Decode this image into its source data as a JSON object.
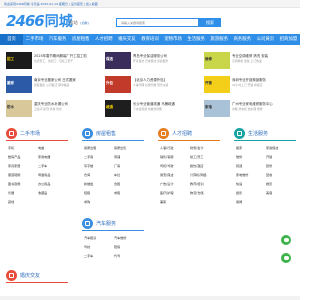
{
  "topbar": {
    "text": "欢迎来到2466同城 今天是 2025-01-19 星期日 | 设为首页 | 加入收藏"
  },
  "logo": {
    "number": "2466",
    "name": "同城"
  },
  "city": {
    "name": "· 总站",
    "switch": "[切换]"
  },
  "search": {
    "placeholder": "请输入关键词搜索",
    "button": "搜索"
  },
  "nav": [
    "首页",
    "二手市场",
    "汽车服务",
    "房屋租售",
    "人才招聘",
    "婚庆交友",
    "教育培训",
    "宠物市场",
    "生活服务",
    "旅游服务",
    "商务服务",
    "公司黄页",
    "招商加盟"
  ],
  "listings": [
    {
      "title": "2025年春节期间服装厂开工招工啦",
      "desc": "急招普工、缝纫工、包装工若干",
      "thumb": "招工",
      "thumb_bg": "#1b1b1b",
      "thumb_fg": "#f5d000"
    },
    {
      "title": "青岛专业保洁服务公司",
      "desc": "开荒保洁 日常保洁 家政服务",
      "thumb": "保洁",
      "thumb_bg": "#3a2d5c",
      "thumb_fg": "#ffffff"
    },
    {
      "title": "专业空调维修 清洗 安装",
      "desc": "空调移机 加氟 上门快速",
      "thumb": "维修",
      "thumb_bg": "#c9d64a",
      "thumb_fg": "#333333"
    },
    {
      "title": "南京专业搬家公司 日式搬家",
      "desc": "居民搬家 公司搬迁 钢琴搬运",
      "thumb": "搬家",
      "thumb_bg": "#2d5aa6",
      "thumb_fg": "#ffffff"
    },
    {
      "title": "【北京人力资源外包】",
      "desc": "人事代理 社保代缴 劳务派遣",
      "thumb": "外包",
      "thumb_bg": "#c23a2a",
      "thumb_fg": "#ffffff"
    },
    {
      "title": "深圳专业开锁换锁服务",
      "desc": "24小时上门 开锁 换锁芯",
      "thumb": "开锁",
      "thumb_bg": "#f3cf1a",
      "thumb_fg": "#333333"
    },
    {
      "title": "重庆专业防水补漏公司",
      "desc": "卫生间 屋顶 外墙 防水",
      "thumb": "防水",
      "thumb_bg": "#d8c89a",
      "thumb_fg": "#333333"
    },
    {
      "title": "长沙专业管道疏通 马桶疏通",
      "desc": "下水道疏通 化粪池清理",
      "thumb": "疏通",
      "thumb_bg": "#1e1e1e",
      "thumb_fg": "#f5d000"
    },
    {
      "title": "广州专业家电维修服务中心",
      "desc": "冰箱 洗衣机 热水器 维修",
      "thumb": "家电",
      "thumb_bg": "#a9c2d8",
      "thumb_fg": "#333333"
    }
  ],
  "categories": [
    {
      "name": "二手市场",
      "sub": "",
      "color": "#e74c3c",
      "links": [
        "手机",
        "电脑",
        "数码产品",
        "家用电器",
        "家具家居",
        "二手车",
        "服装鞋帽",
        "母婴用品",
        "图书音像",
        "办公用品",
        "乐器",
        "收藏品",
        "其他"
      ]
    },
    {
      "name": "房屋租售",
      "sub": "",
      "color": "#3b8fe0",
      "links": [
        "房屋出租",
        "房屋出售",
        "二手房",
        "商铺",
        "写字楼",
        "厂房",
        "仓库",
        "车位",
        "新楼盘",
        "合租",
        "短租",
        "求租",
        "求购"
      ]
    },
    {
      "name": "人才招聘",
      "sub": "",
      "color": "#e67e22",
      "links": [
        "人事/行政",
        "财务/会计",
        "销售/客服",
        "技工/普工",
        "司机/驾驶",
        "餐饮/酒店",
        "保安/保洁",
        "计算机/网络",
        "广告/设计",
        "教育/培训",
        "医疗/护理",
        "物流/仓储",
        "兼职"
      ]
    },
    {
      "name": "生活服务",
      "sub": "",
      "color": "#1aa3a3",
      "links": [
        "搬家",
        "家政保洁",
        "维修",
        "开锁",
        "疏通",
        "装修",
        "家电维修",
        "回收",
        "快递",
        "婚庆",
        "摄影",
        "美容",
        "保姆"
      ]
    },
    {
      "name": "汽车服务",
      "sub": "",
      "color": "#3b8fe0",
      "links": [
        "汽车租赁",
        "汽车维修",
        "驾校",
        "陪练",
        "二手车",
        "代驾"
      ]
    },
    {
      "name": "婚庆交友",
      "sub": "",
      "color": "#e74c3c",
      "links": []
    }
  ]
}
